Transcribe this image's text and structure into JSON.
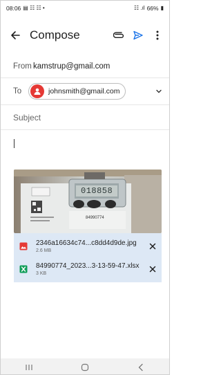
{
  "status_bar": {
    "time": "08:06",
    "notif_icons": "▤ ☷ ☷ •",
    "signal": "☷ .ıl",
    "battery": "66%"
  },
  "app_bar": {
    "title": "Compose"
  },
  "from": {
    "label": "From",
    "value": "kamstrup@gmail.com"
  },
  "to": {
    "label": "To",
    "recipient": "johnsmith@gmail.com"
  },
  "subject": {
    "placeholder": "Subject"
  },
  "attachments": [
    {
      "name": "2346a16634c74...c8dd4d9de.jpg",
      "size": "2.6 MB",
      "icon": "image-icon"
    },
    {
      "name": "84990774_2023...3-13-59-47.xlsx",
      "size": "3 KB",
      "icon": "sheets-icon"
    }
  ],
  "photo": {
    "device_text": "84990774",
    "display_text": "018858"
  },
  "colors": {
    "accent": "#1a73e8",
    "chip_avatar": "#e53935",
    "attachment_bg": "#dde8f5",
    "xlsx_green": "#0f9d58",
    "image_red": "#e53935"
  }
}
